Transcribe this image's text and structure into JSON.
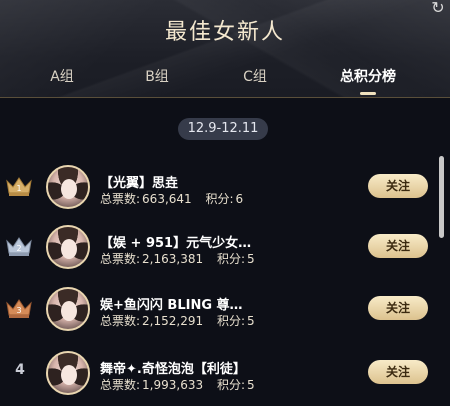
{
  "header": {
    "title": "最佳女新人",
    "refresh_icon": "refresh-icon"
  },
  "tabs": [
    {
      "label": "A组",
      "active": false
    },
    {
      "label": "B组",
      "active": false
    },
    {
      "label": "C组",
      "active": false
    },
    {
      "label": "总积分榜",
      "active": true
    }
  ],
  "date_range": "12.9-12.11",
  "labels": {
    "votes_prefix": "总票数:",
    "points_prefix": "积分:",
    "follow": "关注"
  },
  "colors": {
    "gold": "#d7b06a",
    "silver": "#b9c6d9",
    "bronze": "#d58b58"
  },
  "ranking": [
    {
      "rank": "1",
      "crown": "gold",
      "name": "【光翼】思垚",
      "votes": "663,641",
      "points": "6"
    },
    {
      "rank": "2",
      "crown": "silver",
      "name": "【娱 + 951】元气少女…",
      "votes": "2,163,381",
      "points": "5"
    },
    {
      "rank": "3",
      "crown": "bronze",
      "name": "娱+鱼闪闪 BLING 尊…",
      "votes": "2,152,291",
      "points": "5"
    },
    {
      "rank": "4",
      "crown": "",
      "name": "舞帝✦.奇怪泡泡【利徒】",
      "votes": "1,993,633",
      "points": "5"
    }
  ]
}
